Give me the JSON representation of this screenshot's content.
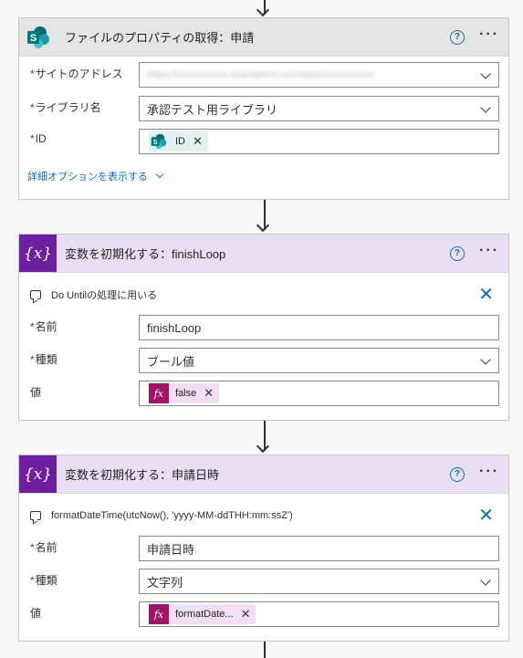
{
  "cards": [
    {
      "title": "ファイルのプロパティの取得：申請",
      "fields": [
        {
          "label": "サイトのアドレス",
          "value": "https://xxxxxxxxxx.sharepoint.com/sites/xxxxxxxxxx"
        },
        {
          "label": "ライブラリ名",
          "value": "承認テスト用ライブラリ"
        },
        {
          "label": "ID",
          "token": "ID"
        }
      ],
      "advanced_link": "詳細オプションを表示する"
    },
    {
      "title": "変数を初期化する：finishLoop",
      "comment": "Do Untilの処理に用いる",
      "fields": [
        {
          "label": "名前",
          "value": "finishLoop"
        },
        {
          "label": "種類",
          "value": "ブール値"
        },
        {
          "label": "値",
          "token": "false"
        }
      ]
    },
    {
      "title": "変数を初期化する：申請日時",
      "comment": "formatDateTime(utcNow(), 'yyyy-MM-ddTHH:mm:ssZ')",
      "fields": [
        {
          "label": "名前",
          "value": "申請日時"
        },
        {
          "label": "種類",
          "value": "文字列"
        },
        {
          "label": "値",
          "token": "formatDate..."
        }
      ]
    }
  ],
  "symbols": {
    "required": "*",
    "variable_icon": "{x}",
    "fx_icon": "fx",
    "help": "?",
    "more": "···",
    "remove": "✕"
  },
  "colors": {
    "sharepoint_teal": "#038387",
    "variable_purple": "#6d1fa1",
    "expression_magenta": "#a1146a",
    "link_blue": "#0f6cbd",
    "required_red": "#a4262c"
  }
}
